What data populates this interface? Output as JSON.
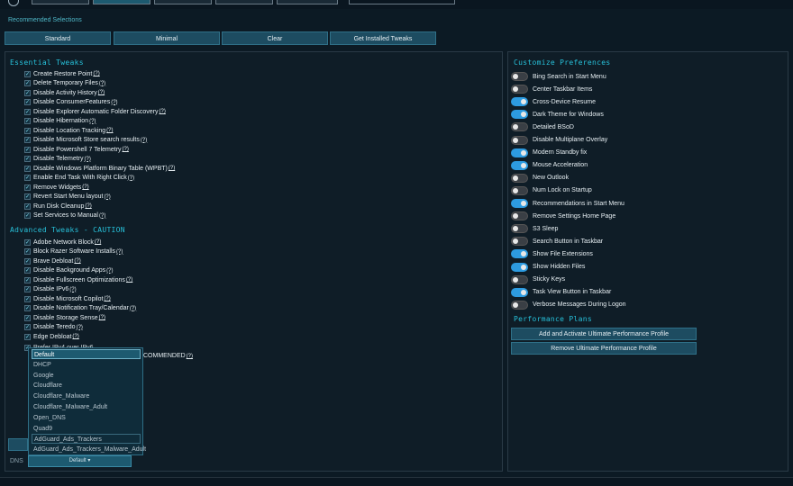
{
  "recommended": {
    "label": "Recommended Selections",
    "buttons": [
      "Standard",
      "Minimal",
      "Clear",
      "Get Installed Tweaks"
    ]
  },
  "essential": {
    "heading": "Essential Tweaks",
    "items": [
      "Create Restore Point",
      "Delete Temporary Files",
      "Disable Activity History",
      "Disable ConsumerFeatures",
      "Disable Explorer Automatic Folder Discovery",
      "Disable Hibernation",
      "Disable Location Tracking",
      "Disable Microsoft Store search results",
      "Disable Powershell 7 Telemetry",
      "Disable Telemetry",
      "Disable Windows Platform Binary Table (WPBT)",
      "Enable End Task With Right Click",
      "Remove Widgets",
      "Revert Start Menu layout",
      "Run Disk Cleanup",
      "Set Services to Manual"
    ]
  },
  "advanced": {
    "heading": "Advanced Tweaks - CAUTION",
    "items": [
      "Adobe Network Block",
      "Block Razer Software Installs",
      "Brave Debloat",
      "Disable Background Apps",
      "Disable Fullscreen Optimizations",
      "Disable IPv6",
      "Disable Microsoft Copilot",
      "Disable Notification Tray/Calendar",
      "Disable Storage Sense",
      "Disable Teredo",
      "Edge Debloat"
    ],
    "partial_item": "COMMENDED"
  },
  "help_glyph": "(?)",
  "preferences": {
    "heading": "Customize Preferences",
    "items": [
      {
        "label": "Bing Search in Start Menu",
        "on": false
      },
      {
        "label": "Center Taskbar Items",
        "on": false
      },
      {
        "label": "Cross-Device Resume",
        "on": true
      },
      {
        "label": "Dark Theme for Windows",
        "on": true
      },
      {
        "label": "Detailed BSoD",
        "on": false
      },
      {
        "label": "Disable Multiplane Overlay",
        "on": false
      },
      {
        "label": "Modern Standby fix",
        "on": true
      },
      {
        "label": "Mouse Acceleration",
        "on": true
      },
      {
        "label": "New Outlook",
        "on": false
      },
      {
        "label": "Num Lock on Startup",
        "on": false
      },
      {
        "label": "Recommendations in Start Menu",
        "on": true
      },
      {
        "label": "Remove Settings Home Page",
        "on": false
      },
      {
        "label": "S3 Sleep",
        "on": false
      },
      {
        "label": "Search Button in Taskbar",
        "on": false
      },
      {
        "label": "Show File Extensions",
        "on": true
      },
      {
        "label": "Show Hidden Files",
        "on": true
      },
      {
        "label": "Sticky Keys",
        "on": false
      },
      {
        "label": "Task View Button in Taskbar",
        "on": true
      },
      {
        "label": "Verbose Messages During Logon",
        "on": false
      }
    ]
  },
  "performance": {
    "heading": "Performance Plans",
    "buttons": [
      "Add and Activate Ultimate Performance Profile",
      "Remove Ultimate Performance Profile"
    ]
  },
  "dns": {
    "label": "DNS",
    "selected": "Default",
    "options": [
      "Default",
      "DHCP",
      "Google",
      "Cloudflare",
      "Cloudflare_Malware",
      "Cloudflare_Malware_Adult",
      "Open_DNS",
      "Quad9",
      "AdGuard_Ads_Trackers",
      "AdGuard_Ads_Trackers_Malware_Adult"
    ]
  },
  "colors": {
    "accent": "#27c0d9",
    "button": "#1d4c61",
    "toggle_on": "#2d9be0",
    "background": "#0c1a24"
  }
}
